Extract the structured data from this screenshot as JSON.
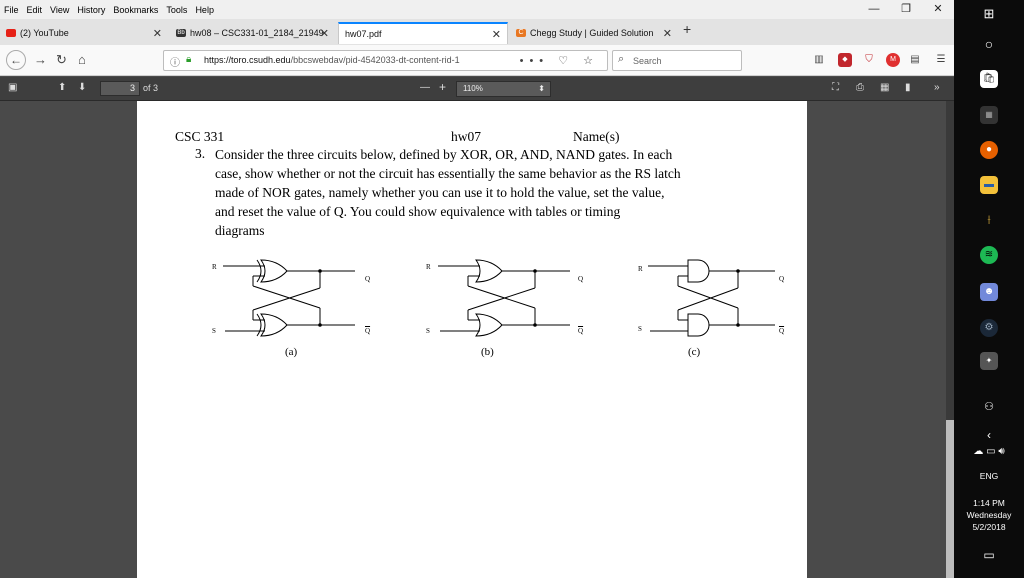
{
  "menu": [
    "File",
    "Edit",
    "View",
    "History",
    "Bookmarks",
    "Tools",
    "Help"
  ],
  "window_controls": [
    "—",
    "❐",
    "✕"
  ],
  "tabs": [
    {
      "label": "(2) YouTube",
      "color": "#e62117"
    },
    {
      "label": "hw08 – CSC331-01_2184_21949",
      "color": "#333333"
    },
    {
      "label": "hw07.pdf",
      "color": ""
    },
    {
      "label": "Chegg Study | Guided Solution",
      "color": "#e87722"
    }
  ],
  "newtab_label": "+",
  "url": {
    "host": "https://toro.csudh.edu",
    "path": "/bbcswebdav/pid-4542033-dt-content-rid-1"
  },
  "url_icons": "••• ♡ ☆",
  "search_placeholder": "Search",
  "pdf": {
    "page_current": "3",
    "page_total": "of 3",
    "zoom": "110%"
  },
  "doc": {
    "course": "CSC 331",
    "hw": "hw07",
    "names": "Name(s)",
    "qnum": "3.",
    "paragraph": "Consider the three circuits below, defined by XOR, OR, AND, NAND gates. In each\ncase, show whether or not the circuit has essentially the same behavior as the RS latch\nmade of NOR gates, namely whether you can use it to hold the value, set the value,\nand reset the value of Q.   You could show equivalence with tables or timing\ndiagrams",
    "circuits": [
      {
        "caption": "(a)",
        "r": "R",
        "s": "S",
        "q": "Q",
        "qbar": "Q"
      },
      {
        "caption": "(b)",
        "r": "R",
        "s": "S",
        "q": "Q",
        "qbar": "Q"
      },
      {
        "caption": "(c)",
        "r": "R",
        "s": "S",
        "q": "Q",
        "qbar": "Q"
      }
    ]
  },
  "taskbar": {
    "lang": "ENG",
    "time": "1:14 PM",
    "day": "Wednesday",
    "date": "5/2/2018"
  }
}
